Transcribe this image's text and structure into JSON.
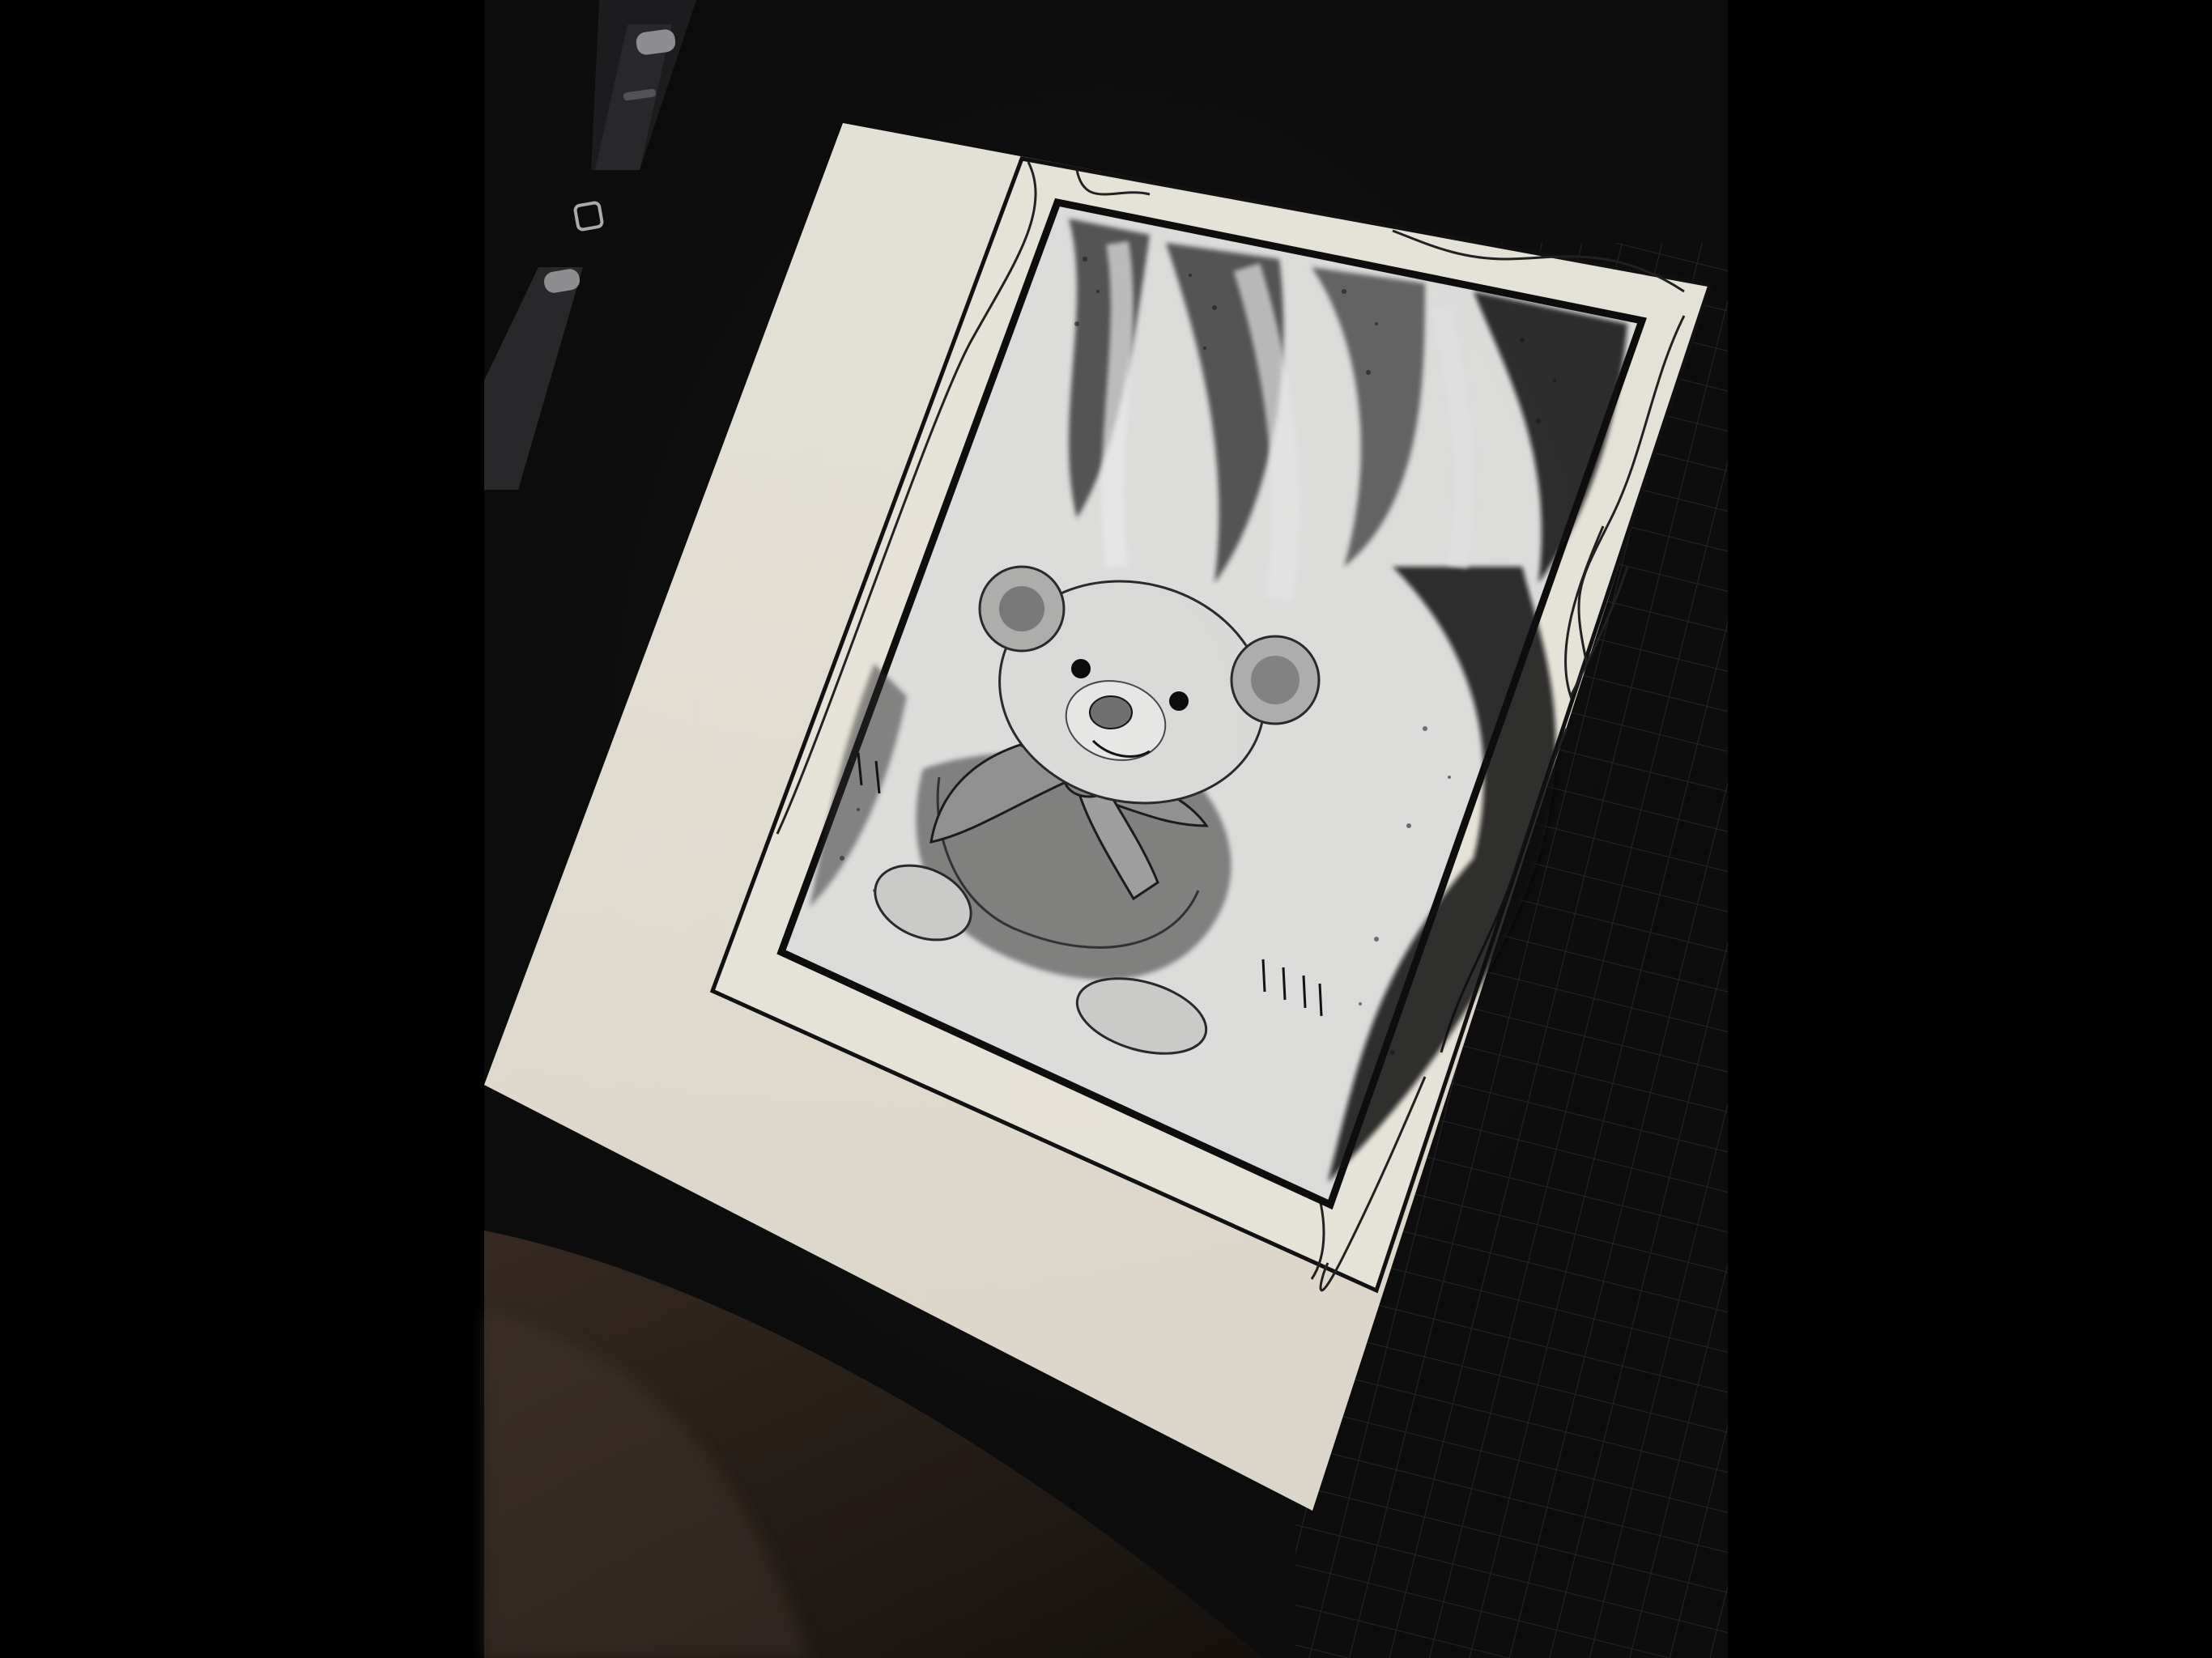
{
  "scene": {
    "description_kind": "photo-of-tablet-drawing-app",
    "canvas_background": "#f4efe2",
    "app_background": "#0b0b0c",
    "outer_background": "#000000",
    "ink_color": "#111111"
  },
  "sidebar": {
    "brush_size_slider": {
      "icon": "slider-handle"
    },
    "modify_button": {
      "icon": "square-outline-icon"
    },
    "opacity_slider": {
      "icon": "slider-handle"
    }
  },
  "artwork": {
    "subject": "teddy-bear",
    "style": "black-and-white-stipple"
  }
}
